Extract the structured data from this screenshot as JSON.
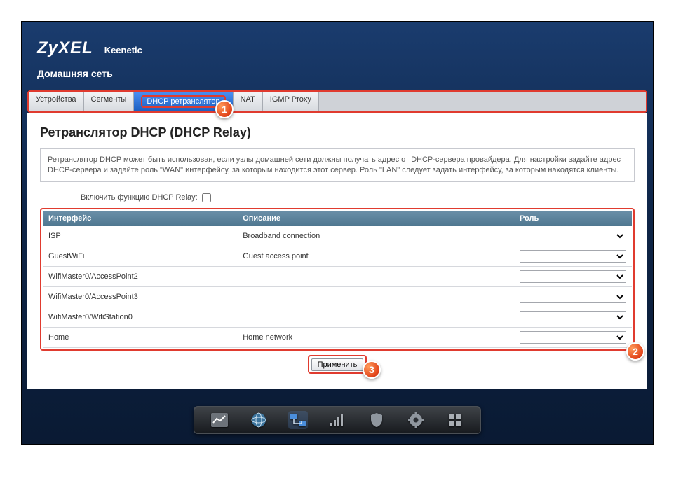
{
  "brand": "ZyXEL",
  "model": "Keenetic",
  "section": "Домашняя сеть",
  "tabs": [
    {
      "label": "Устройства"
    },
    {
      "label": "Сегменты"
    },
    {
      "label": "DHCP ретранслятор"
    },
    {
      "label": "NAT"
    },
    {
      "label": "IGMP Proxy"
    }
  ],
  "active_tab_index": 2,
  "page_heading": "Ретранслятор DHCP (DHCP Relay)",
  "info_text": "Ретранслятор DHCP может быть использован, если узлы домашней сети должны получать адрес от DHCP-сервера провайдера. Для настройки задайте адрес DHCP-сервера и задайте роль \"WAN\" интерфейсу, за которым находится этот сервер. Роль \"LAN\" следует задать интерфейсу, за которым находятся клиенты.",
  "enable_label": "Включить функцию DHCP Relay:",
  "enable_checked": false,
  "columns": {
    "interface": "Интерфейс",
    "description": "Описание",
    "role": "Роль"
  },
  "rows": [
    {
      "interface": "ISP",
      "description": "Broadband connection",
      "role": ""
    },
    {
      "interface": "GuestWiFi",
      "description": "Guest access point",
      "role": ""
    },
    {
      "interface": "WifiMaster0/AccessPoint2",
      "description": "",
      "role": ""
    },
    {
      "interface": "WifiMaster0/AccessPoint3",
      "description": "",
      "role": ""
    },
    {
      "interface": "WifiMaster0/WifiStation0",
      "description": "",
      "role": ""
    },
    {
      "interface": "Home",
      "description": "Home network",
      "role": ""
    }
  ],
  "apply_label": "Применить",
  "markers": {
    "one": "1",
    "two": "2",
    "three": "3"
  },
  "dock": [
    {
      "name": "stats-icon"
    },
    {
      "name": "globe-icon"
    },
    {
      "name": "network-icon"
    },
    {
      "name": "wifi-bars-icon"
    },
    {
      "name": "shield-icon"
    },
    {
      "name": "gear-icon"
    },
    {
      "name": "apps-icon"
    }
  ],
  "active_dock_index": 2
}
